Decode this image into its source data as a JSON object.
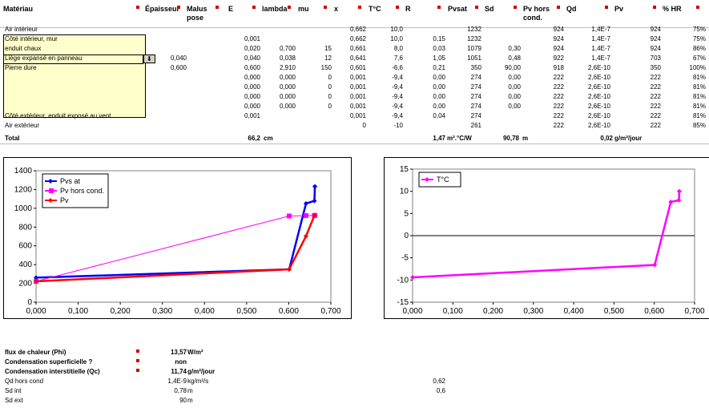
{
  "headers": [
    {
      "id": "materiau",
      "label": "Matériau",
      "x": 4
    },
    {
      "id": "epaisseur",
      "label": "Épaisseur",
      "x": 181
    },
    {
      "id": "malus",
      "label": "Malus pose",
      "x": 233
    },
    {
      "id": "E",
      "label": "E",
      "x": 285
    },
    {
      "id": "lambda",
      "label": "lambda",
      "x": 327
    },
    {
      "id": "mu",
      "label": "mu",
      "x": 372
    },
    {
      "id": "x",
      "label": "x",
      "x": 417
    },
    {
      "id": "tc",
      "label": "T°C",
      "x": 460
    },
    {
      "id": "R",
      "label": "R",
      "x": 506
    },
    {
      "id": "pvsat",
      "label": "Pvsat",
      "x": 559
    },
    {
      "id": "sd",
      "label": "Sd",
      "x": 605
    },
    {
      "id": "pvhors",
      "label": "Pv hors cond.",
      "x": 653
    },
    {
      "id": "qd",
      "label": "Qd",
      "x": 707
    },
    {
      "id": "pv",
      "label": "Pv",
      "x": 767
    },
    {
      "id": "hr",
      "label": "% HR",
      "x": 827
    }
  ],
  "rows": [
    {
      "mat": "Air intérieur",
      "ep": "",
      "E": "",
      "lam": "",
      "mu": "",
      "x": "0,662",
      "t": "10,0",
      "R": "",
      "pvsat": "1232",
      "sd": "",
      "pvh": "924",
      "qd": "1,4E-7",
      "pv": "924",
      "hr": "75%"
    },
    {
      "mat": "Côté intérieur, mur",
      "ep": "",
      "E": "0,001",
      "lam": "",
      "mu": "",
      "x": "0,662",
      "t": "10,0",
      "R": "0,15",
      "pvsat": "1232",
      "sd": "",
      "pvh": "924",
      "qd": "1,4E-7",
      "pv": "924",
      "hr": "75%"
    },
    {
      "mat": "enduit chaux",
      "ep": "",
      "E": "0,020",
      "lam": "0,700",
      "mu": "15",
      "x": "0,661",
      "t": "8,0",
      "R": "0,03",
      "pvsat": "1079",
      "sd": "0,30",
      "pvh": "924",
      "qd": "1,4E-7",
      "pv": "924",
      "hr": "86%"
    },
    {
      "mat": "Liège expansé en panneau",
      "ep": "0,040",
      "E": "0,040",
      "lam": "0,038",
      "mu": "12",
      "x": "0,641",
      "t": "7,6",
      "R": "1,05",
      "pvsat": "1051",
      "sd": "0,48",
      "pvh": "922",
      "qd": "1,4E-7",
      "pv": "703",
      "hr": "67%"
    },
    {
      "mat": "Pierre dure",
      "ep": "0,600",
      "E": "0,600",
      "lam": "2,910",
      "mu": "150",
      "x": "0,601",
      "t": "-6,6",
      "R": "0,21",
      "pvsat": "350",
      "sd": "90,00",
      "pvh": "918",
      "qd": "2,6E-10",
      "pv": "350",
      "hr": "100%"
    },
    {
      "mat": "",
      "ep": "",
      "E": "0,000",
      "lam": "0,000",
      "mu": "0",
      "x": "0,001",
      "t": "-9,4",
      "R": "0,00",
      "pvsat": "274",
      "sd": "0,00",
      "pvh": "222",
      "qd": "2,6E-10",
      "pv": "222",
      "hr": "81%"
    },
    {
      "mat": "",
      "ep": "",
      "E": "0,000",
      "lam": "0,000",
      "mu": "0",
      "x": "0,001",
      "t": "-9,4",
      "R": "0,00",
      "pvsat": "274",
      "sd": "0,00",
      "pvh": "222",
      "qd": "2,6E-10",
      "pv": "222",
      "hr": "81%"
    },
    {
      "mat": "",
      "ep": "",
      "E": "0,000",
      "lam": "0,000",
      "mu": "0",
      "x": "0,001",
      "t": "-9,4",
      "R": "0,00",
      "pvsat": "274",
      "sd": "0,00",
      "pvh": "222",
      "qd": "2,6E-10",
      "pv": "222",
      "hr": "81%"
    },
    {
      "mat": "",
      "ep": "",
      "E": "0,000",
      "lam": "0,000",
      "mu": "0",
      "x": "0,001",
      "t": "-9,4",
      "R": "0,00",
      "pvsat": "274",
      "sd": "0,00",
      "pvh": "222",
      "qd": "2,6E-10",
      "pv": "222",
      "hr": "81%"
    },
    {
      "mat": "Côté extérieur, enduit exposé au vent",
      "ep": "",
      "E": "0,001",
      "lam": "",
      "mu": "",
      "x": "0,001",
      "t": "-9,4",
      "R": "0,04",
      "pvsat": "274",
      "sd": "",
      "pvh": "222",
      "qd": "2,6E-10",
      "pv": "222",
      "hr": "81%"
    },
    {
      "mat": "Air extérieur",
      "ep": "",
      "E": "",
      "lam": "",
      "mu": "",
      "x": "0",
      "t": "-10",
      "R": "",
      "pvsat": "261",
      "sd": "",
      "pvh": "222",
      "qd": "2,6E-10",
      "pv": "222",
      "hr": "85%"
    }
  ],
  "total": {
    "label": "Total",
    "E": "66,2",
    "E_unit": "cm",
    "R": "1,47",
    "R_unit": "m².°C/W",
    "sd": "90,78",
    "sd_unit": "m",
    "qd": "0,02",
    "qd_unit": "g/m²/jour"
  },
  "summary": [
    {
      "label": "flux de chaleur (Phi)",
      "value": "13,57",
      "unit": "W/m²",
      "bold": true
    },
    {
      "label": "Condensation superficielle ?",
      "value": "non",
      "unit": "",
      "bold": true
    },
    {
      "label": "Condensation interstitielle (Qc)",
      "value": "11,74",
      "unit": "g/m²/jour",
      "bold": true
    },
    {
      "label": "Qd hors cond",
      "value": "1,4E-9",
      "unit": "kg/m²/s",
      "bold": false,
      "extra": "0,62"
    },
    {
      "label": "Sd int",
      "value": "0,78",
      "unit": "m",
      "bold": false,
      "extra": "0,6"
    },
    {
      "label": "Sd ext",
      "value": "90",
      "unit": "m",
      "bold": false,
      "extra": ""
    }
  ],
  "chart_data": [
    {
      "type": "line",
      "xlim": [
        0,
        0.7
      ],
      "ylim": [
        0,
        1400
      ],
      "xticks": [
        "0,000",
        "0,100",
        "0,200",
        "0,300",
        "0,400",
        "0,500",
        "0,600",
        "0,700"
      ],
      "yticks": [
        "0",
        "200",
        "400",
        "600",
        "800",
        "1000",
        "1200",
        "1400"
      ],
      "legend_position": "top-left",
      "series": [
        {
          "name": "Pvs at",
          "color": "#0000ff",
          "x": [
            0,
            0.601,
            0.641,
            0.661,
            0.662,
            0.662
          ],
          "y": [
            261,
            350,
            1051,
            1079,
            1232,
            1232
          ]
        },
        {
          "name": "Pv hors cond.",
          "color": "#ff00ff",
          "x": [
            0,
            0.601,
            0.641,
            0.661,
            0.662
          ],
          "y": [
            222,
            918,
            922,
            924,
            924
          ]
        },
        {
          "name": "Pv",
          "color": "#ff0000",
          "x": [
            0,
            0.601,
            0.641,
            0.661,
            0.662
          ],
          "y": [
            222,
            350,
            703,
            924,
            924
          ]
        }
      ]
    },
    {
      "type": "line",
      "xlim": [
        0,
        0.7
      ],
      "ylim": [
        -15,
        15
      ],
      "xticks": [
        "0,000",
        "0,100",
        "0,200",
        "0,300",
        "0,400",
        "0,500",
        "0,600",
        "0,700"
      ],
      "yticks": [
        "15",
        "10",
        "5",
        "0",
        "-5",
        "-10",
        "-15"
      ],
      "legend_position": "top-left",
      "series": [
        {
          "name": "T°C",
          "color": "#ff00ff",
          "x": [
            0,
            0.601,
            0.641,
            0.661,
            0.662
          ],
          "y": [
            -9.4,
            -6.6,
            7.6,
            8.0,
            10.0
          ]
        }
      ]
    }
  ]
}
